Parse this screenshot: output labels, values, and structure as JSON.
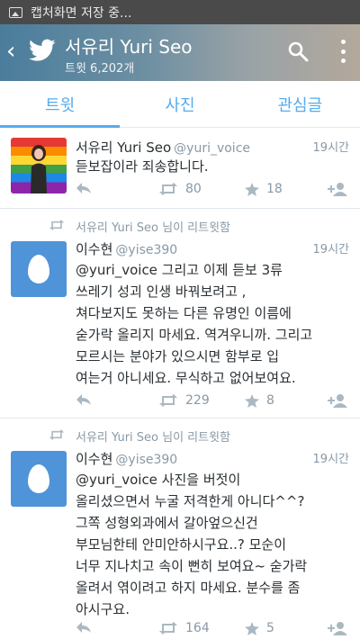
{
  "status": {
    "text": "캡처화면 저장 중..."
  },
  "header": {
    "title": "서유리 Yuri Seo",
    "subtitle": "트윗 6,202개"
  },
  "tabs": [
    {
      "label": "트윗",
      "active": true
    },
    {
      "label": "사진",
      "active": false
    },
    {
      "label": "관심글",
      "active": false
    }
  ],
  "tweets": [
    {
      "retweet_by": "",
      "name": "서유리 Yuri Seo",
      "handle": "@yuri_voice",
      "time": "19시간",
      "text": "듣보잡이라 죄송합니다.",
      "retweets": "80",
      "favorites": "18"
    },
    {
      "retweet_by": "서유리 Yuri Seo 님이 리트윗함",
      "name": "이수현",
      "handle": "@yise390",
      "time": "19시간",
      "text": "@yuri_voice  그리고 이제 듣보 3류\n쓰레기 성괴 인생 바꿔보려고 ,\n쳐다보지도 못하는 다른 유명인 이름에\n숟가락 올리지 마세요. 역겨우니까. 그리고\n모르시는 분야가 있으시면 함부로 입\n여는거 아니세요. 무식하고 없어보여요.",
      "retweets": "229",
      "favorites": "8"
    },
    {
      "retweet_by": "서유리 Yuri Seo 님이 리트윗함",
      "name": "이수현",
      "handle": "@yise390",
      "time": "19시간",
      "text": "@yuri_voice  사진을 버젓이\n올리셨으면서 누굴 저격한게 아니다^^?\n그쪽 성형외과에서 갈아엎으신건\n부모님한테 안미안하시구요..? 모순이\n너무 지나치고 속이 뻔히 보여요~ 숟가락\n올려서 엮이려고 하지 마세요. 분수를 좀\n아시구요.",
      "retweets": "164",
      "favorites": "5"
    }
  ],
  "colors": {
    "accent": "#55acee",
    "muted": "#8899a6",
    "text": "#292f33"
  }
}
